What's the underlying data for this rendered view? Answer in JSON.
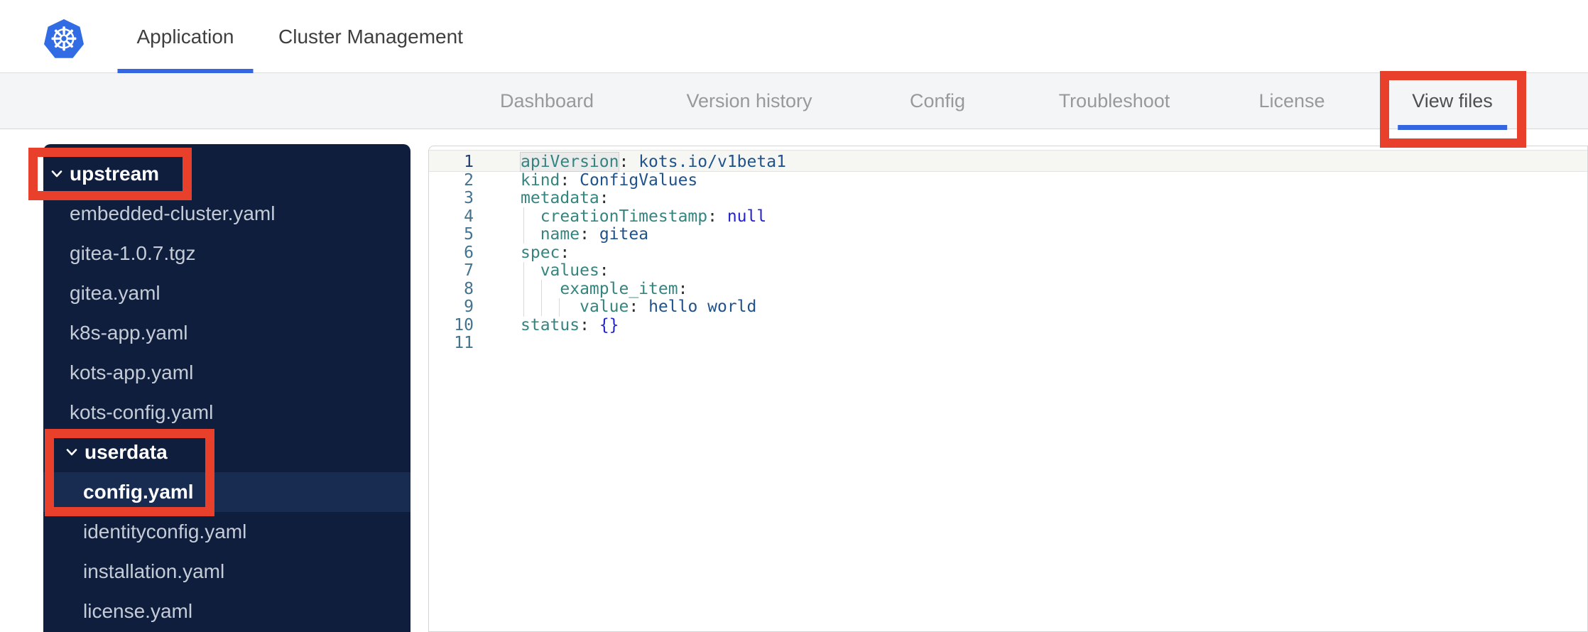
{
  "colors": {
    "accent": "#3366e0",
    "annotation": "#e8402a",
    "logo_blue": "#326ce5",
    "sidebar_bg": "#0e1e3c",
    "sidebar_selected": "#172c50",
    "yaml_key": "#35847f",
    "yaml_value": "#20538c",
    "yaml_keyword": "#2424cf"
  },
  "header": {
    "logo_icon": "kubernetes-helm-wheel-icon",
    "logo_glyph": "☸",
    "tabs": [
      {
        "label": "Application",
        "active": true
      },
      {
        "label": "Cluster Management",
        "active": false
      }
    ]
  },
  "subnav": {
    "items": [
      {
        "label": "Dashboard",
        "active": false
      },
      {
        "label": "Version history",
        "active": false
      },
      {
        "label": "Config",
        "active": false
      },
      {
        "label": "Troubleshoot",
        "active": false
      },
      {
        "label": "License",
        "active": false
      },
      {
        "label": "View files",
        "active": true
      }
    ]
  },
  "file_tree": {
    "items": [
      {
        "label": "upstream",
        "type": "folder",
        "level": 0,
        "expanded": true
      },
      {
        "label": "embedded-cluster.yaml",
        "type": "file",
        "level": 1
      },
      {
        "label": "gitea-1.0.7.tgz",
        "type": "file",
        "level": 1
      },
      {
        "label": "gitea.yaml",
        "type": "file",
        "level": 1
      },
      {
        "label": "k8s-app.yaml",
        "type": "file",
        "level": 1
      },
      {
        "label": "kots-app.yaml",
        "type": "file",
        "level": 1
      },
      {
        "label": "kots-config.yaml",
        "type": "file",
        "level": 1
      },
      {
        "label": "userdata",
        "type": "folder",
        "level": 1,
        "expanded": true
      },
      {
        "label": "config.yaml",
        "type": "file",
        "level": 2,
        "selected": true
      },
      {
        "label": "identityconfig.yaml",
        "type": "file",
        "level": 2
      },
      {
        "label": "installation.yaml",
        "type": "file",
        "level": 2
      },
      {
        "label": "license.yaml",
        "type": "file",
        "level": 2
      }
    ]
  },
  "editor": {
    "lines": [
      {
        "num": "1",
        "active": true,
        "tokens": [
          {
            "c": "key",
            "v": "apiVersion",
            "hl": true
          },
          {
            "c": "pun",
            "v": ":"
          },
          {
            "c": "sp",
            "v": " "
          },
          {
            "c": "val",
            "v": "kots.io/v1beta1"
          }
        ]
      },
      {
        "num": "2",
        "tokens": [
          {
            "c": "key",
            "v": "kind"
          },
          {
            "c": "pun",
            "v": ":"
          },
          {
            "c": "sp",
            "v": " "
          },
          {
            "c": "val",
            "v": "ConfigValues"
          }
        ]
      },
      {
        "num": "3",
        "tokens": [
          {
            "c": "key",
            "v": "metadata"
          },
          {
            "c": "pun",
            "v": ":"
          }
        ]
      },
      {
        "num": "4",
        "tokens": [
          {
            "c": "sp",
            "v": "  "
          },
          {
            "c": "key",
            "v": "creationTimestamp"
          },
          {
            "c": "pun",
            "v": ":"
          },
          {
            "c": "sp",
            "v": " "
          },
          {
            "c": "kw",
            "v": "null"
          }
        ]
      },
      {
        "num": "5",
        "tokens": [
          {
            "c": "sp",
            "v": "  "
          },
          {
            "c": "key",
            "v": "name"
          },
          {
            "c": "pun",
            "v": ":"
          },
          {
            "c": "sp",
            "v": " "
          },
          {
            "c": "val",
            "v": "gitea"
          }
        ]
      },
      {
        "num": "6",
        "tokens": [
          {
            "c": "key",
            "v": "spec"
          },
          {
            "c": "pun",
            "v": ":"
          }
        ]
      },
      {
        "num": "7",
        "tokens": [
          {
            "c": "sp",
            "v": "  "
          },
          {
            "c": "key",
            "v": "values"
          },
          {
            "c": "pun",
            "v": ":"
          }
        ]
      },
      {
        "num": "8",
        "tokens": [
          {
            "c": "sp",
            "v": "    "
          },
          {
            "c": "key",
            "v": "example_item"
          },
          {
            "c": "pun",
            "v": ":"
          }
        ]
      },
      {
        "num": "9",
        "tokens": [
          {
            "c": "sp",
            "v": "      "
          },
          {
            "c": "key",
            "v": "value"
          },
          {
            "c": "pun",
            "v": ":"
          },
          {
            "c": "sp",
            "v": " "
          },
          {
            "c": "val",
            "v": "hello world"
          }
        ]
      },
      {
        "num": "10",
        "tokens": [
          {
            "c": "key",
            "v": "status"
          },
          {
            "c": "pun",
            "v": ":"
          },
          {
            "c": "sp",
            "v": " "
          },
          {
            "c": "kw",
            "v": "{}"
          }
        ]
      },
      {
        "num": "11",
        "tokens": []
      }
    ]
  },
  "annotations": {
    "boxes": [
      "view-files-tab",
      "upstream-folder",
      "userdata-config-selection"
    ]
  }
}
